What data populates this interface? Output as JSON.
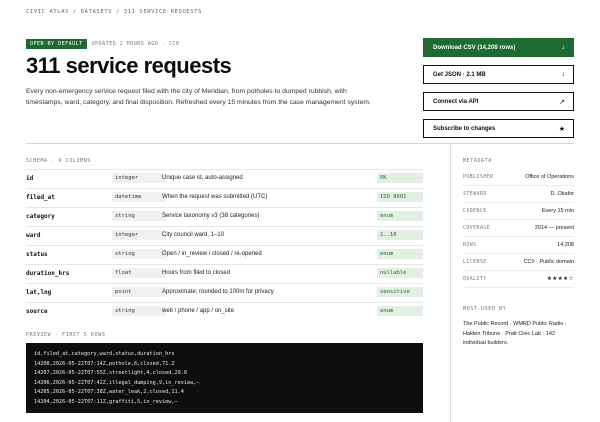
{
  "breadcrumb": "CIVIC ATLAS / DATASETS / 311 SERVICE REQUESTS",
  "header": {
    "badge": "OPEN BY DEFAULT",
    "updated": "UPDATED 2 HOURS AGO · CC0",
    "title": "311 service requests",
    "description": "Every non-emergency service request filed with the city of Meridian, from potholes to dumped rubbish, with timestamps, ward, category, and final disposition. Refreshed every 15 minutes from the case management system."
  },
  "actions": [
    {
      "label": "Download CSV (14,208 rows)",
      "icon": "↓",
      "icon_name": "download-icon"
    },
    {
      "label": "Get JSON · 2.1 MB",
      "icon": "↓",
      "icon_name": "download-icon"
    },
    {
      "label": "Connect via API",
      "icon": "↗",
      "icon_name": "external-link-icon"
    },
    {
      "label": "Subscribe to changes",
      "icon": "★",
      "icon_name": "star-icon"
    }
  ],
  "schema": {
    "label": "SCHEMA · 9 COLUMNS",
    "rows": [
      {
        "name": "id",
        "type": "integer",
        "desc": "Unique case id, auto-assigned",
        "tag": "PK"
      },
      {
        "name": "filed_at",
        "type": "datetime",
        "desc": "When the request was submitted (UTC)",
        "tag": "ISO 8601"
      },
      {
        "name": "category",
        "type": "string",
        "desc": "Service taxonomy v3 (38 categories)",
        "tag": "enum"
      },
      {
        "name": "ward",
        "type": "integer",
        "desc": "City council ward, 1–10",
        "tag": "1..10"
      },
      {
        "name": "status",
        "type": "string",
        "desc": "Open / in_review / closed / re-opened",
        "tag": "enum"
      },
      {
        "name": "duration_hrs",
        "type": "float",
        "desc": "Hours from filed to closed",
        "tag": "nullable"
      },
      {
        "name": "lat,lng",
        "type": "point",
        "desc": "Approximate; rounded to 100m for privacy",
        "tag": "sensitive"
      },
      {
        "name": "source",
        "type": "string",
        "desc": "web / phone / app / on_site",
        "tag": "enum"
      }
    ]
  },
  "metadata": {
    "label": "METADATA",
    "rows": [
      {
        "key": "PUBLISHER",
        "value": "Office of Operations"
      },
      {
        "key": "STEWARD",
        "value": "D. Okafor"
      },
      {
        "key": "CADENCE",
        "value": "Every 15 min"
      },
      {
        "key": "COVERAGE",
        "value": "2014 — present"
      },
      {
        "key": "ROWS",
        "value": "14,208"
      },
      {
        "key": "LICENSE",
        "value": "CC0 · Public domain"
      },
      {
        "key": "QUALITY",
        "value": "★★★★☆"
      }
    ]
  },
  "most_used": {
    "label": "MOST-USED BY",
    "text": "The Public Record · WMRD Public Radio · Halden Tribune · Pratt Civic Lab · 142 individual builders."
  },
  "preview": {
    "label": "PREVIEW · FIRST 5 ROWS",
    "lines": "id,filed_at,category,ward,status,duration_hrs\n14208,2026-05-22T07:14Z,pothole,6,closed,71.2\n14207,2026-05-22T07:55Z,streetlight,4,closed,29.8\n14206,2026-05-22T07:42Z,illegal_dumping,9,in_review,–\n14205,2026-05-22T07:38Z,water_leak,2,closed,11.4\n14204,2026-05-22T07:11Z,graffiti,5,in_review,–"
  },
  "colors": {
    "accent": "#1e6b32",
    "preview_bg": "#0e0e0e"
  }
}
